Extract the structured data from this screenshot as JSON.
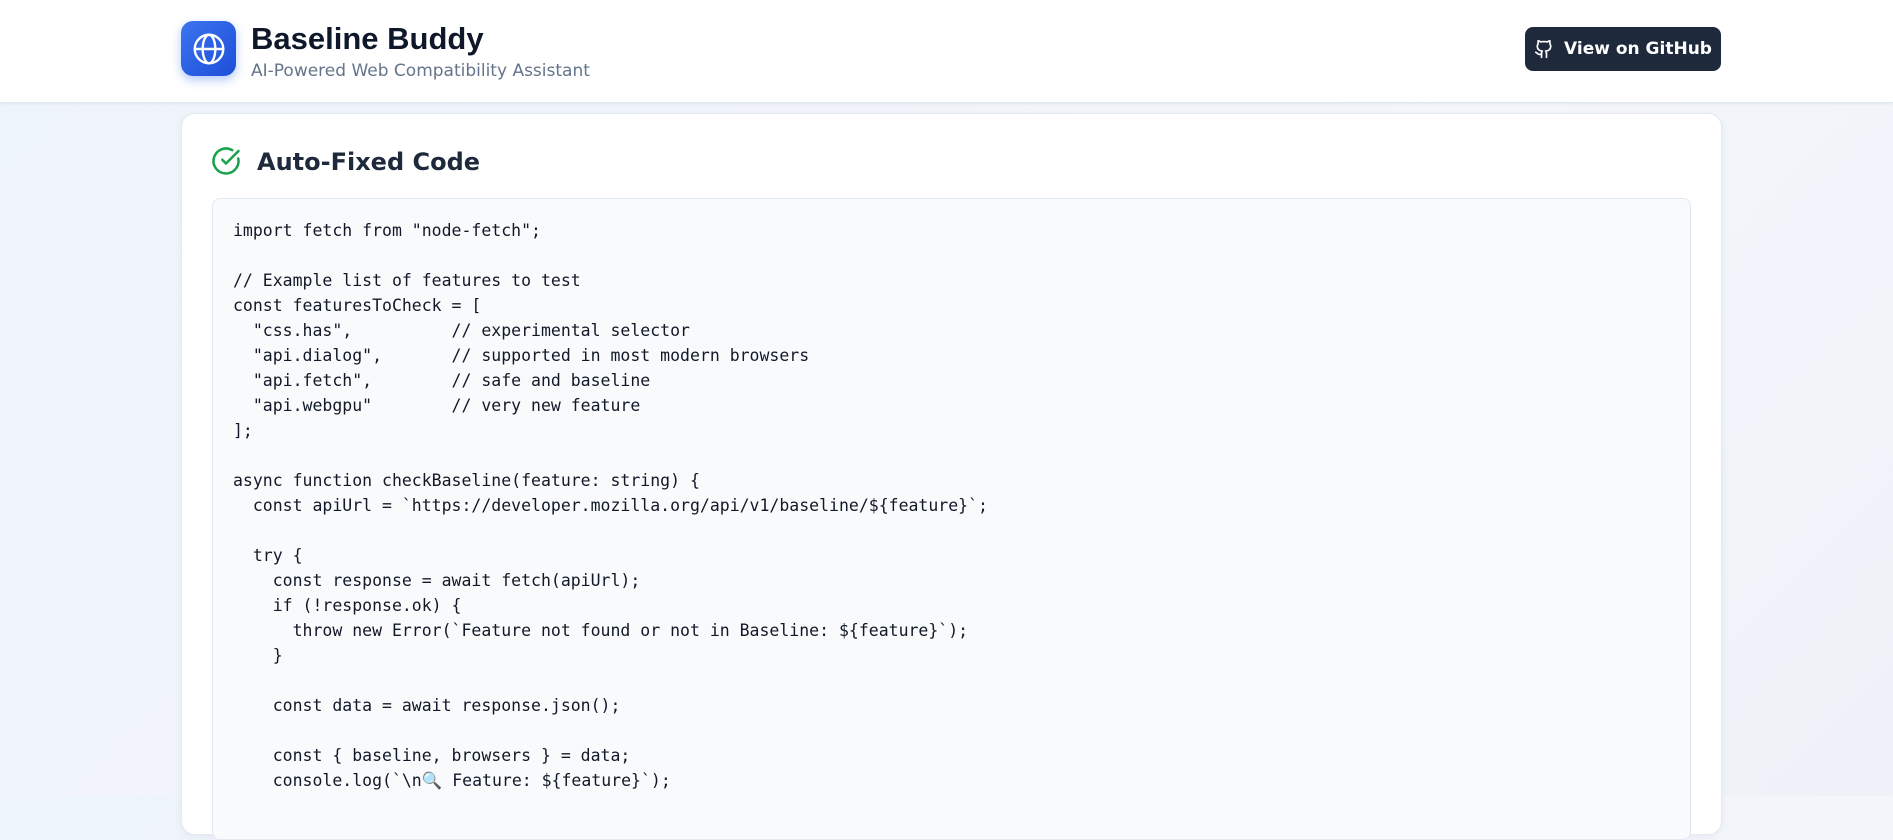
{
  "app": {
    "title": "Baseline Buddy",
    "subtitle": "AI-Powered Web Compatibility Assistant",
    "logo_icon": "globe-icon",
    "accent_color": "#2563eb"
  },
  "header": {
    "github_button_label": "View on GitHub",
    "github_icon": "github-icon",
    "button_color": "#1e293b"
  },
  "card": {
    "title": "Auto-Fixed Code",
    "status_icon": "check-circle-icon",
    "status_color": "#16a34a",
    "code": "import fetch from \"node-fetch\";\n\n// Example list of features to test\nconst featuresToCheck = [\n  \"css.has\",          // experimental selector\n  \"api.dialog\",       // supported in most modern browsers\n  \"api.fetch\",        // safe and baseline\n  \"api.webgpu\"        // very new feature\n];\n\nasync function checkBaseline(feature: string) {\n  const apiUrl = `https://developer.mozilla.org/api/v1/baseline/${feature}`;\n\n  try {\n    const response = await fetch(apiUrl);\n    if (!response.ok) {\n      throw new Error(`Feature not found or not in Baseline: ${feature}`);\n    }\n\n    const data = await response.json();\n\n    const { baseline, browsers } = data;\n    console.log(`\\n🔍 Feature: ${feature}`);"
  }
}
